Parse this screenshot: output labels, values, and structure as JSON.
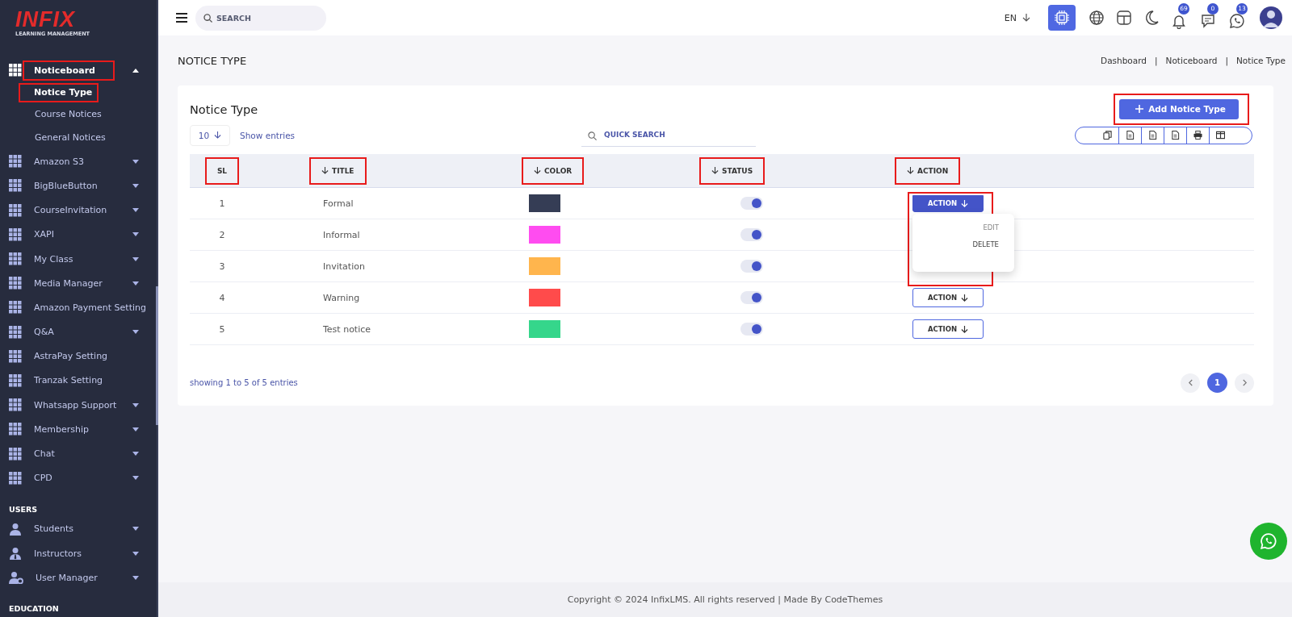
{
  "sidebar": {
    "logo": "INFIX",
    "logo_sub": "LEARNING MANAGEMENT",
    "sections": [
      {
        "items": [
          {
            "label": "Noticeboard",
            "kind": "grid",
            "expanded": true,
            "has_caret": true,
            "highlight": true,
            "children": [
              {
                "label": "Notice Type",
                "selected": true,
                "highlight": true
              },
              {
                "label": "Course Notices",
                "selected": false,
                "highlight": false
              },
              {
                "label": "General Notices",
                "selected": false,
                "highlight": false
              }
            ]
          },
          {
            "label": "Amazon S3",
            "kind": "grid",
            "expanded": false,
            "has_caret": true,
            "highlight": false
          },
          {
            "label": "BigBlueButton",
            "kind": "grid",
            "expanded": false,
            "has_caret": true,
            "highlight": false
          },
          {
            "label": "CourseInvitation",
            "kind": "grid",
            "expanded": false,
            "has_caret": true,
            "highlight": false
          },
          {
            "label": "XAPI",
            "kind": "grid",
            "expanded": false,
            "has_caret": true,
            "highlight": false
          },
          {
            "label": "My Class",
            "kind": "grid",
            "expanded": false,
            "has_caret": true,
            "highlight": false
          },
          {
            "label": "Media Manager",
            "kind": "grid",
            "expanded": false,
            "has_caret": true,
            "highlight": false
          },
          {
            "label": "Amazon Payment Setting",
            "kind": "grid",
            "expanded": false,
            "has_caret": false,
            "highlight": false
          },
          {
            "label": "Q&A",
            "kind": "grid",
            "expanded": false,
            "has_caret": true,
            "highlight": false
          },
          {
            "label": "AstraPay Setting",
            "kind": "grid",
            "expanded": false,
            "has_caret": false,
            "highlight": false
          },
          {
            "label": "Tranzak Setting",
            "kind": "grid",
            "expanded": false,
            "has_caret": false,
            "highlight": false
          },
          {
            "label": "Whatsapp Support",
            "kind": "grid",
            "expanded": false,
            "has_caret": true,
            "highlight": false
          },
          {
            "label": "Membership",
            "kind": "grid",
            "expanded": false,
            "has_caret": true,
            "highlight": false
          },
          {
            "label": "Chat",
            "kind": "grid",
            "expanded": false,
            "has_caret": true,
            "highlight": false
          },
          {
            "label": "CPD",
            "kind": "grid",
            "expanded": false,
            "has_caret": true,
            "highlight": false
          }
        ]
      },
      {
        "heading": "USERS",
        "items": [
          {
            "label": "Students",
            "kind": "user",
            "expanded": false,
            "has_caret": true,
            "highlight": false
          },
          {
            "label": "Instructors",
            "kind": "tie",
            "expanded": false,
            "has_caret": true,
            "highlight": false
          },
          {
            "label": "User Manager",
            "kind": "usergear",
            "expanded": false,
            "has_caret": true,
            "highlight": false
          }
        ]
      },
      {
        "heading": "EDUCATION"
      }
    ]
  },
  "topbar": {
    "search_placeholder": "SEARCH",
    "language": "EN",
    "badges": [
      {
        "kind": "bell",
        "count": "69"
      },
      {
        "kind": "chat",
        "count": "0"
      },
      {
        "kind": "phone",
        "count": "13"
      }
    ]
  },
  "page": {
    "title": "NOTICE TYPE",
    "breadcrumbs": [
      "Dashboard",
      "Noticeboard",
      "Notice Type"
    ],
    "separator": "|"
  },
  "card": {
    "title": "Notice Type",
    "add_button": {
      "label": "Add Notice Type",
      "highlight": true
    },
    "page_size": "10",
    "show_entries": "Show entries",
    "quick_search_placeholder": "QUICK SEARCH",
    "columns": [
      {
        "label": "SL",
        "sortable": false,
        "highlight": true
      },
      {
        "label": "TITLE",
        "sortable": true,
        "highlight": true
      },
      {
        "label": "COLOR",
        "sortable": true,
        "highlight": true
      },
      {
        "label": "STATUS",
        "sortable": true,
        "highlight": true
      },
      {
        "label": "ACTION",
        "sortable": true,
        "highlight": true
      }
    ],
    "rows": [
      {
        "sl": "1",
        "title": "Formal",
        "color": "#353d55",
        "on": true,
        "action": {
          "label": "ACTION",
          "open": true,
          "menu": [
            "EDIT",
            "DELETE"
          ],
          "highlight": true
        }
      },
      {
        "sl": "2",
        "title": "Informal",
        "color": "#ff4cf0",
        "on": true
      },
      {
        "sl": "3",
        "title": "Invitation",
        "color": "#ffb54d",
        "on": true
      },
      {
        "sl": "4",
        "title": "Warning",
        "color": "#ff4b4b",
        "on": true,
        "action": {
          "label": "ACTION",
          "open": false
        }
      },
      {
        "sl": "5",
        "title": "Test notice",
        "color": "#35d68b",
        "on": true,
        "action": {
          "label": "ACTION",
          "open": false
        }
      }
    ],
    "summary": "showing 1 to 5 of 5 entries",
    "pages": [
      {
        "label": "1",
        "selected": true
      }
    ]
  },
  "footer": "Copyright © 2024 InfixLMS. All rights reserved | Made By CodeThemes"
}
